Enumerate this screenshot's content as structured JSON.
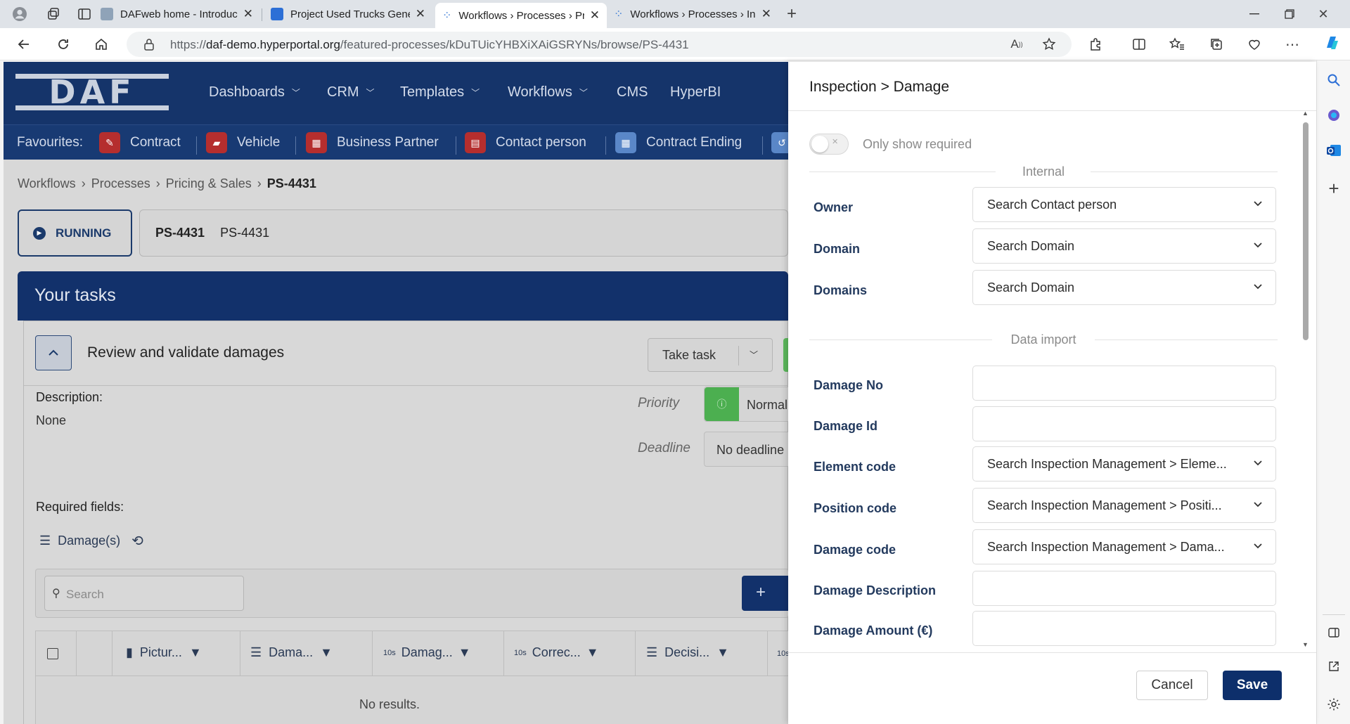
{
  "browser": {
    "tabs": [
      {
        "title": "DAFweb home - Introductiepagin",
        "active": false
      },
      {
        "title": "Project Used Trucks General Tean",
        "active": false
      },
      {
        "title": "Workflows › Processes › Pricing &",
        "active": true
      },
      {
        "title": "Workflows › Processes › Inspectic",
        "active": false
      }
    ],
    "url_prefix": "https://",
    "url_host": "daf-demo.hyperportal.org",
    "url_path": "/featured-processes/kDuTUicYHBXiXAiGSRYNs/browse/PS-4431"
  },
  "app": {
    "logo": "DAF",
    "nav": [
      "Dashboards",
      "CRM",
      "Templates",
      "Workflows",
      "CMS",
      "HyperBI"
    ],
    "favourites_label": "Favourites:",
    "favourites": [
      "Contract",
      "Vehicle",
      "Business Partner",
      "Contact person",
      "Contract Ending"
    ],
    "breadcrumb": [
      "Workflows",
      "Processes",
      "Pricing & Sales",
      "PS-4431"
    ],
    "status": "RUNNING",
    "process_id": "PS-4431",
    "process_name": "PS-4431",
    "tasks_title": "Your tasks",
    "task_title": "Review and validate damages",
    "take_task": "Take task",
    "description_label": "Description:",
    "description_value": "None",
    "priority_label": "Priority",
    "priority_value": "Normal",
    "deadline_label": "Deadline",
    "deadline_value": "No deadline",
    "required_label": "Required fields:",
    "required_item": "Damage(s)",
    "search_placeholder": "Search",
    "columns": [
      "Pictur...",
      "Dama...",
      "Damag...",
      "Correc...",
      "Decisi..."
    ],
    "col_prefix": "10s",
    "no_results": "No results."
  },
  "drawer": {
    "title": "Inspection > Damage",
    "toggle_label": "Only show required",
    "section_internal": "Internal",
    "section_import": "Data import",
    "fields": [
      {
        "label": "Owner",
        "value": "Search Contact person",
        "dropdown": true
      },
      {
        "label": "Domain",
        "value": "Search Domain",
        "dropdown": true
      },
      {
        "label": "Domains",
        "value": "Search Domain",
        "dropdown": true
      },
      {
        "label": "Damage No",
        "value": "",
        "dropdown": false
      },
      {
        "label": "Damage Id",
        "value": "",
        "dropdown": false
      },
      {
        "label": "Element code",
        "value": "Search Inspection Management > Eleme...",
        "dropdown": true
      },
      {
        "label": "Position code",
        "value": "Search Inspection Management > Positi...",
        "dropdown": true
      },
      {
        "label": "Damage code",
        "value": "Search Inspection Management > Dama...",
        "dropdown": true
      },
      {
        "label": "Damage Description",
        "value": "",
        "dropdown": false
      },
      {
        "label": "Damage Amount (€)",
        "value": "",
        "dropdown": false
      }
    ],
    "cancel_label": "Cancel",
    "save_label": "Save"
  },
  "colors": {
    "nav_bg": "#15346a",
    "primary_button": "#0d2f6b",
    "status_green": "#4caf50"
  }
}
